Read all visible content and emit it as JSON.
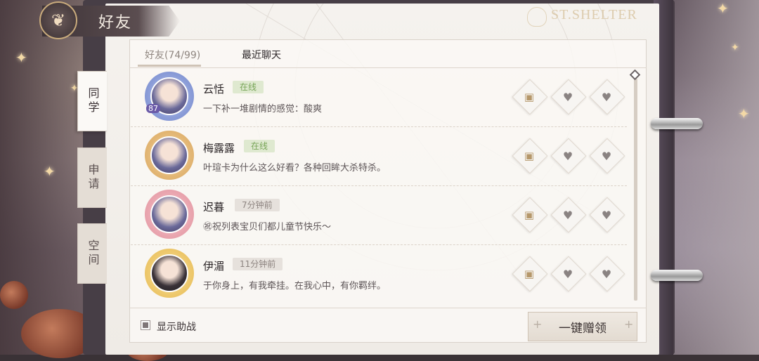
{
  "header": {
    "title": "好友",
    "logo_text": "ST.SHELTER",
    "emblem_icon": "butterfly-icon"
  },
  "side_tabs": [
    {
      "label": "同学",
      "active": true
    },
    {
      "label": "申请",
      "active": false
    },
    {
      "label": "空间",
      "active": false
    }
  ],
  "tabs": [
    {
      "label": "好友(74/99)",
      "active": true
    },
    {
      "label": "最近聊天",
      "active": false
    }
  ],
  "friends": [
    {
      "name": "云恬",
      "status": "在线",
      "status_type": "online",
      "message": "一下补一堆剧情的感觉：酸爽",
      "avatar_badge": "87"
    },
    {
      "name": "梅露露",
      "status": "在线",
      "status_type": "online",
      "message": "叶瑄卡为什么这么好看？各种回眸大杀特杀。",
      "avatar_badge": ""
    },
    {
      "name": "迟暮",
      "status": "7分钟前",
      "status_type": "offline",
      "message": "㊗祝列表宝贝们都儿童节快乐～",
      "avatar_badge": ""
    },
    {
      "name": "伊湄",
      "status": "11分钟前",
      "status_type": "offline",
      "message": "于你身上，有我牵挂。在我心中，有你羁绊。",
      "avatar_badge": ""
    }
  ],
  "footer": {
    "checkbox_label": "显示助战",
    "checkbox_checked": true,
    "claim_button": "一键赠领"
  },
  "colors": {
    "online": "#78a558",
    "offline": "#8d8480",
    "accent": "#b5976a"
  }
}
